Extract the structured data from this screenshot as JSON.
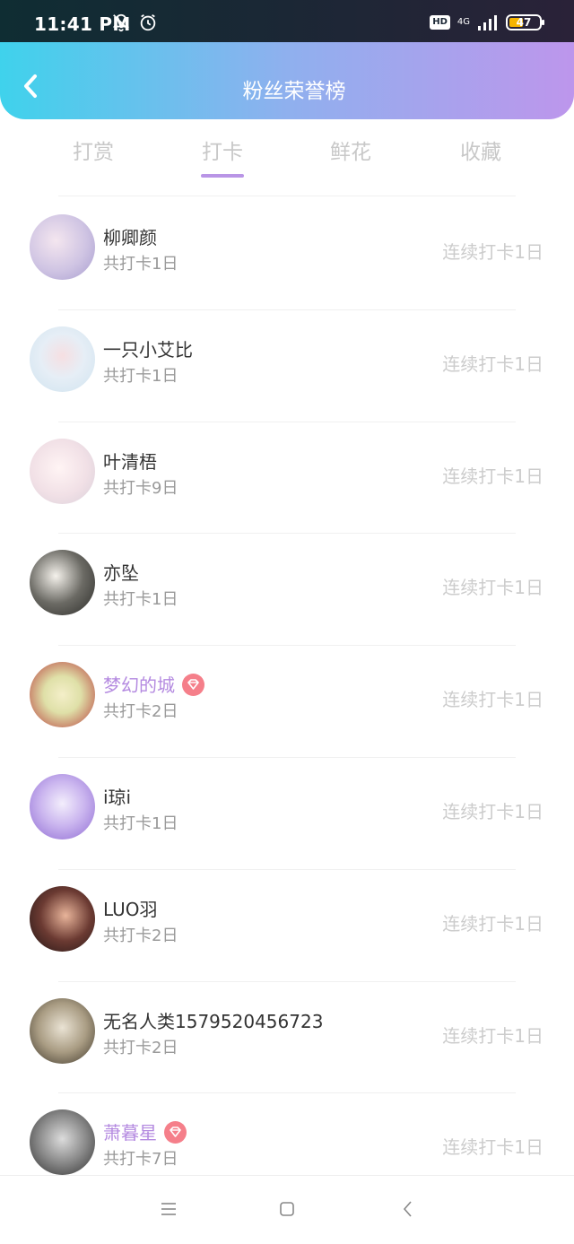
{
  "status_bar": {
    "time": "11:41 PM",
    "icons": [
      "mute-bell-icon",
      "alarm-icon"
    ],
    "hd": "HD",
    "network": "4G",
    "battery": "47"
  },
  "header": {
    "title": "粉丝荣誉榜",
    "back_icon": "chevron-left-icon"
  },
  "tabs": [
    {
      "label": "打赏",
      "active": false
    },
    {
      "label": "打卡",
      "active": true
    },
    {
      "label": "鲜花",
      "active": false
    },
    {
      "label": "收藏",
      "active": false
    }
  ],
  "colors": {
    "accent": "#b48ae0",
    "vip_badge": "#f57f8a",
    "header_gradient_start": "#3fd2ec",
    "header_gradient_end": "#bd96ec"
  },
  "fans": [
    {
      "name": "柳卿颜",
      "total": "共打卡1日",
      "streak": "连续打卡1日",
      "vip": false
    },
    {
      "name": "一只小艾比",
      "total": "共打卡1日",
      "streak": "连续打卡1日",
      "vip": false
    },
    {
      "name": "叶清梧",
      "total": "共打卡9日",
      "streak": "连续打卡1日",
      "vip": false
    },
    {
      "name": "亦坠",
      "total": "共打卡1日",
      "streak": "连续打卡1日",
      "vip": false
    },
    {
      "name": "梦幻的城",
      "total": "共打卡2日",
      "streak": "连续打卡1日",
      "vip": true
    },
    {
      "name": "i琼i",
      "total": "共打卡1日",
      "streak": "连续打卡1日",
      "vip": false
    },
    {
      "name": "LUO羽",
      "total": "共打卡2日",
      "streak": "连续打卡1日",
      "vip": false
    },
    {
      "name": "无名人类1579520456723",
      "total": "共打卡2日",
      "streak": "连续打卡1日",
      "vip": false
    },
    {
      "name": "萧暮星",
      "total": "共打卡7日",
      "streak": "连续打卡1日",
      "vip": true
    }
  ],
  "nav_bar": {
    "icons": [
      "menu-icon",
      "home-square-icon",
      "back-triangle-icon"
    ]
  }
}
